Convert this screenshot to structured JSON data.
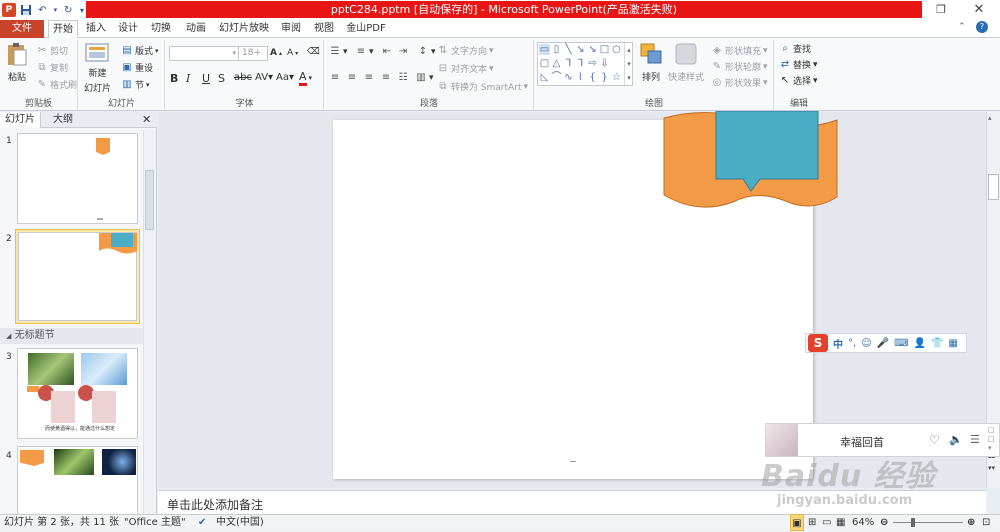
{
  "window": {
    "title": "pptC284.pptm [自动保存的] - Microsoft PowerPoint(产品激活失败)"
  },
  "tabs": [
    "文件",
    "开始",
    "插入",
    "设计",
    "切换",
    "动画",
    "幻灯片放映",
    "审阅",
    "视图",
    "金山PDF"
  ],
  "clipboard": {
    "paste": "粘贴",
    "cut": "剪切",
    "copy": "复制",
    "format_painter": "格式刷",
    "group": "剪贴板"
  },
  "slides_group": {
    "new_slide": "新建",
    "new_slide_2": "幻灯片",
    "layout": "版式",
    "reset": "重设",
    "section": "节",
    "group": "幻灯片"
  },
  "font_group": {
    "font_size": "18+",
    "group": "字体"
  },
  "paragraph_group": {
    "text_direction": "文字方向",
    "align_text": "对齐文本",
    "smartart": "转换为 SmartArt",
    "group": "段落"
  },
  "drawing_group": {
    "arrange": "排列",
    "quick_styles": "快速样式",
    "shape_fill": "形状填充",
    "shape_outline": "形状轮廓",
    "shape_effects": "形状效果",
    "group": "绘图"
  },
  "editing_group": {
    "find": "查找",
    "replace": "替换",
    "select": "选择",
    "group": "编辑"
  },
  "left_panel": {
    "tab_slides": "幻灯片",
    "tab_outline": "大纲",
    "section": "无标题节",
    "slide_numbers": [
      "1",
      "2",
      "3",
      "4"
    ],
    "thumb3_caption": "而使黄酒得以，能通过什么想定"
  },
  "notes": {
    "placeholder": "单击此处添加备注"
  },
  "status": {
    "slide_info": "幻灯片 第 2 张，共 11 张",
    "theme": "\"Office 主题\"",
    "language": "中文(中国)",
    "zoom": "64%"
  },
  "ime": {
    "mode": "中"
  },
  "music": {
    "title": "幸福回首"
  },
  "watermark": {
    "brand": "Baidu 经验",
    "url": "jingyan.baidu.com"
  },
  "colors": {
    "file_tab": "#c9432a",
    "title_band": "#e81515",
    "ribbon_shape_orange": "#f39a47",
    "ribbon_shape_blue": "#4aacc5"
  }
}
